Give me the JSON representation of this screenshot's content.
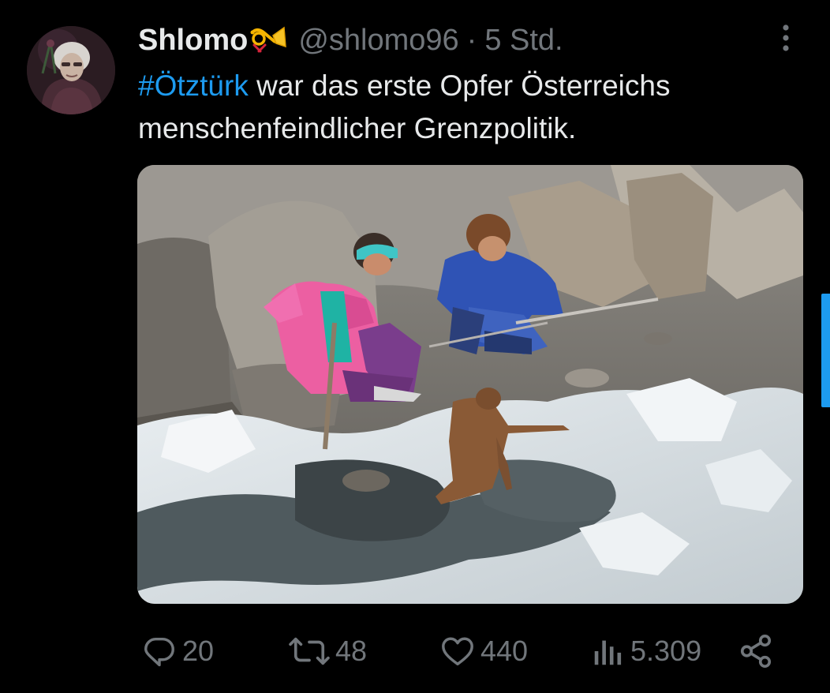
{
  "post": {
    "author": {
      "display_name": "Shlomo",
      "badge_icon": "posthorn-emoji",
      "handle": "@shlomo96",
      "separator": "·",
      "timestamp": "5 Std."
    },
    "text": {
      "hashtag": "#Ötztürk",
      "body": " war das erste Opfer Österreichs menschenfeindlicher Grenzpolitik."
    },
    "media": {
      "type": "photo",
      "subject": "two hikers kneeling beside a mummified body on a melting glacier"
    },
    "actions": {
      "replies": "20",
      "reposts": "48",
      "likes": "440",
      "views": "5.309"
    }
  },
  "colors": {
    "background": "#000000",
    "text_primary": "#e7e9ea",
    "text_secondary": "#71767b",
    "accent": "#1d9bf0"
  }
}
